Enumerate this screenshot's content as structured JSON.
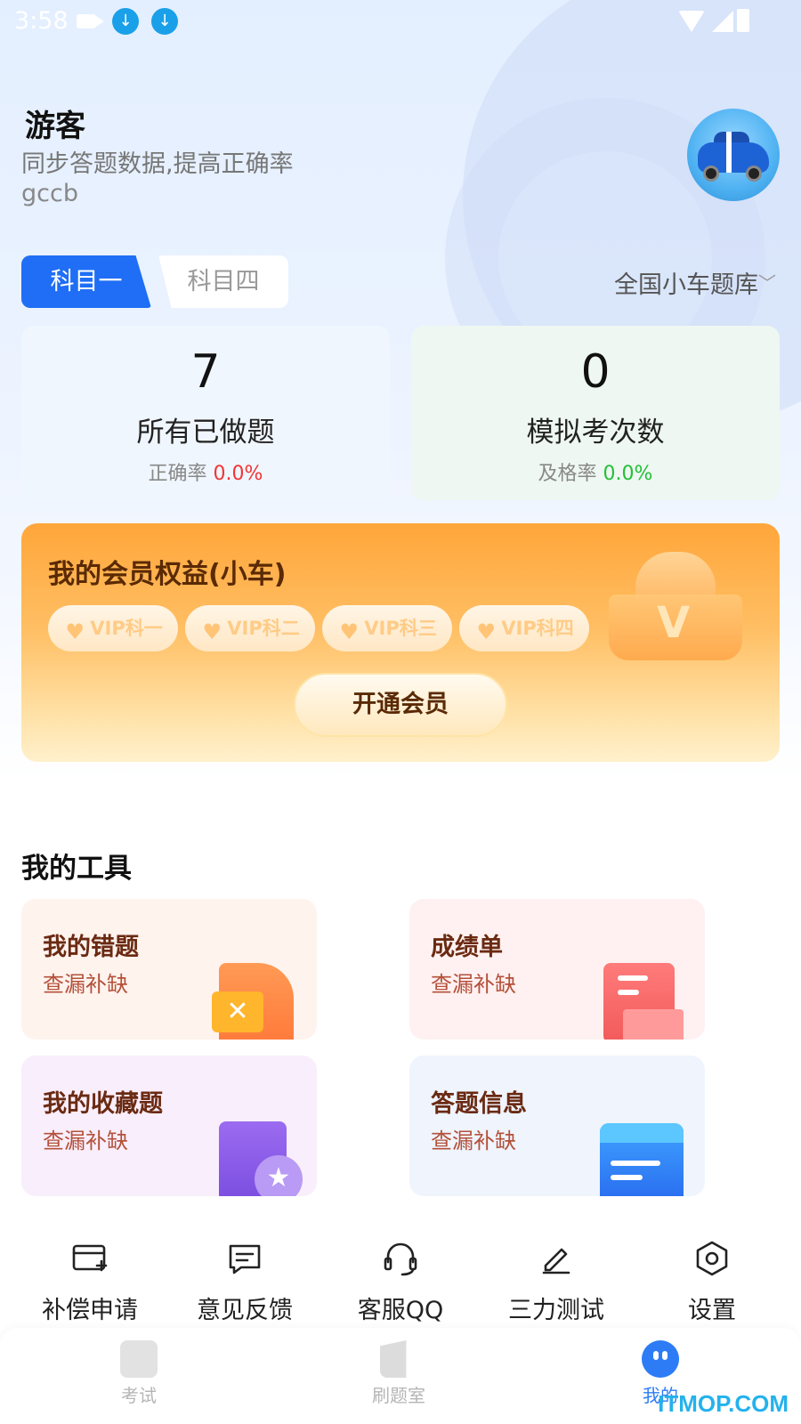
{
  "status_bar": {
    "time": "3:58"
  },
  "profile": {
    "name": "游客",
    "subtitle": "同步答题数据,提高正确率",
    "user_id": "gccb"
  },
  "subject_tabs": [
    {
      "label": "科目一",
      "active": true
    },
    {
      "label": "科目四",
      "active": false
    }
  ],
  "question_bank": {
    "label": "全国小车题库"
  },
  "stats": [
    {
      "value": "7",
      "label": "所有已做题",
      "rate_label": "正确率",
      "rate_value": "0.0%",
      "rate_color": "#f33535"
    },
    {
      "value": "0",
      "label": "模拟考次数",
      "rate_label": "及格率",
      "rate_value": "0.0%",
      "rate_color": "#25c038"
    }
  ],
  "vip": {
    "title": "我的会员权益(小车)",
    "chips": [
      "VIP科一",
      "VIP科二",
      "VIP科三",
      "VIP科四"
    ],
    "button": "开通会员"
  },
  "tools": {
    "title": "我的工具",
    "items": [
      {
        "title": "我的错题",
        "subtitle": "查漏补缺",
        "icon": "wrong-questions-icon"
      },
      {
        "title": "成绩单",
        "subtitle": "查漏补缺",
        "icon": "score-report-icon"
      },
      {
        "title": "我的收藏题",
        "subtitle": "查漏补缺",
        "icon": "favorites-icon"
      },
      {
        "title": "答题信息",
        "subtitle": "查漏补缺",
        "icon": "answer-info-icon"
      }
    ]
  },
  "quick_actions": [
    {
      "label": "补偿申请",
      "icon": "card-plus-icon"
    },
    {
      "label": "意见反馈",
      "icon": "feedback-icon"
    },
    {
      "label": "客服QQ",
      "icon": "headset-icon"
    },
    {
      "label": "三力测试",
      "icon": "pen-icon"
    },
    {
      "label": "设置",
      "icon": "settings-icon"
    }
  ],
  "bottom_nav": [
    {
      "label": "考试",
      "active": false
    },
    {
      "label": "刷题室",
      "active": false
    },
    {
      "label": "我的",
      "active": true
    }
  ],
  "watermark": "ITMOP.COM"
}
